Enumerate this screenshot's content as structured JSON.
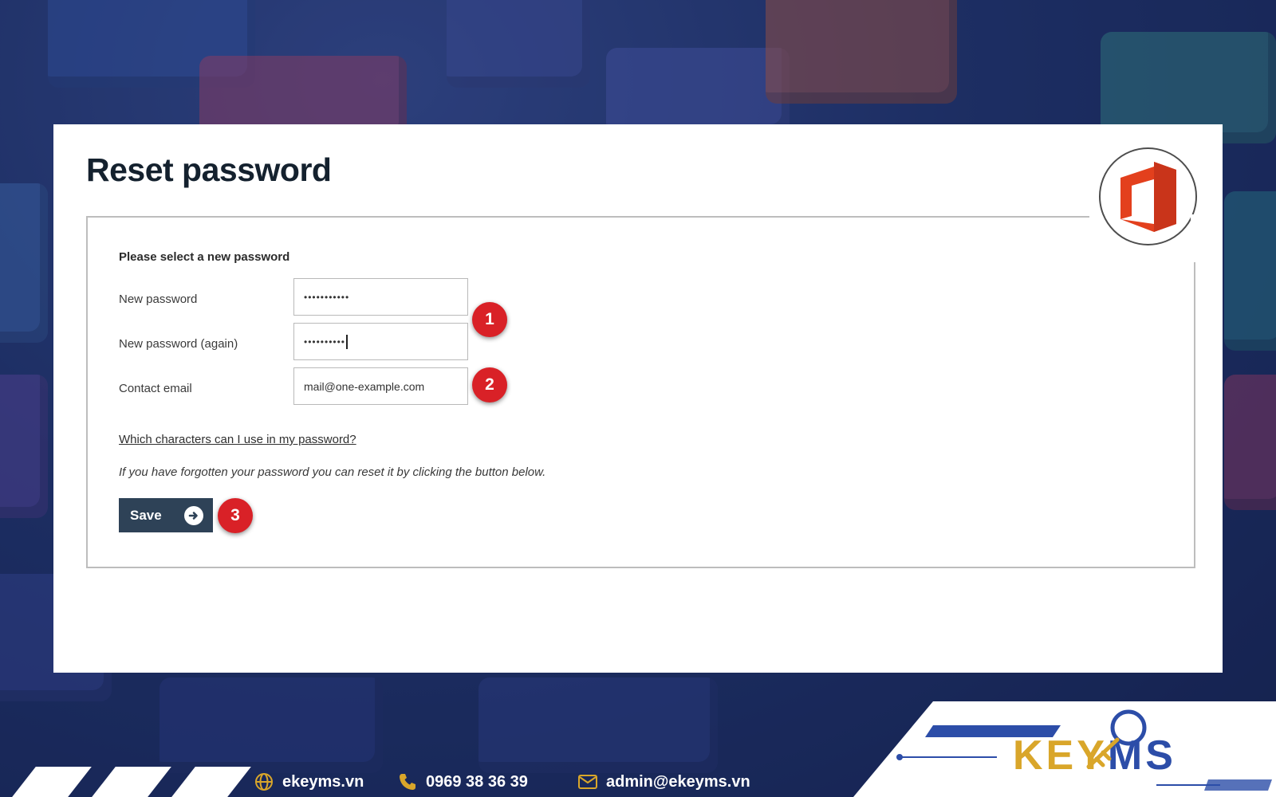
{
  "page": {
    "title": "Reset password",
    "form_heading": "Please select a new password"
  },
  "form": {
    "new_password": {
      "label": "New password",
      "value": "•••••••••••"
    },
    "new_password_again": {
      "label": "New password (again)",
      "value": "••••••••••"
    },
    "contact_email": {
      "label": "Contact email",
      "value": "mail@one-example.com"
    }
  },
  "help_link": "Which characters can I use in my password?",
  "help_text": "If you have forgotten your password you can reset it by clicking the button below.",
  "save_label": "Save",
  "badges": [
    "1",
    "2",
    "3"
  ],
  "footer": {
    "website": "ekeyms.vn",
    "phone": "0969 38 36 39",
    "email": "admin@ekeyms.vn",
    "brand_part1": "KEY",
    "brand_part2": "MS"
  },
  "colors": {
    "badge": "#d92127",
    "save_button": "#2e4257",
    "office_logo": "#e3401d",
    "brand_blue": "#2c4da8",
    "brand_gold": "#d9a62a",
    "footer_icon": "#d9a62a"
  },
  "icons": [
    "office-logo-icon",
    "save-arrow-icon",
    "globe-icon",
    "phone-icon",
    "mail-icon",
    "key-logo-icon"
  ]
}
